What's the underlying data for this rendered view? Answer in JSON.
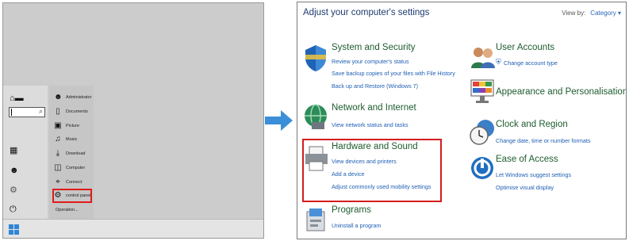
{
  "start_menu": {
    "items": [
      {
        "label": "Administrator",
        "icon": "user-icon"
      },
      {
        "label": "Documents",
        "icon": "document-icon"
      },
      {
        "label": "Picture",
        "icon": "picture-icon"
      },
      {
        "label": "Music",
        "icon": "music-icon"
      },
      {
        "label": "Download",
        "icon": "download-icon"
      },
      {
        "label": "Computer",
        "icon": "computer-icon"
      },
      {
        "label": "Connect",
        "icon": "connect-icon"
      },
      {
        "label": "control panel",
        "icon": "gear-icon"
      },
      {
        "label": "Operation...",
        "icon": ""
      }
    ],
    "highlight_color": "#e01b1b"
  },
  "control_panel": {
    "title": "Adjust your computer's settings",
    "view_by_label": "View by:",
    "view_by_value": "Category ▾",
    "categories": {
      "system": {
        "title": "System and Security",
        "links": [
          "Review your computer's status",
          "Save backup copies of your files with File History",
          "Back up and Restore (Windows 7)"
        ]
      },
      "network": {
        "title": "Network and Internet",
        "links": [
          "View network status and tasks"
        ]
      },
      "hardware": {
        "title": "Hardware and Sound",
        "links": [
          "View devices and printers",
          "Add a device",
          "Adjust commonly used mobility settings"
        ]
      },
      "programs": {
        "title": "Programs",
        "links": [
          "Uninstall a program"
        ]
      },
      "users": {
        "title": "User Accounts",
        "links": [
          "Change account type"
        ]
      },
      "appearance": {
        "title": "Appearance and Personalisation",
        "links": []
      },
      "clock": {
        "title": "Clock and Region",
        "links": [
          "Change date, time or number formats"
        ]
      },
      "ease": {
        "title": "Ease of Access",
        "links": [
          "Let Windows suggest settings",
          "Optimise visual display"
        ]
      }
    },
    "highlight_color": "#d51c1c"
  },
  "colors": {
    "heading": "#1d5c2e",
    "link": "#1f5fb4",
    "arrow": "#3a8fd8"
  }
}
